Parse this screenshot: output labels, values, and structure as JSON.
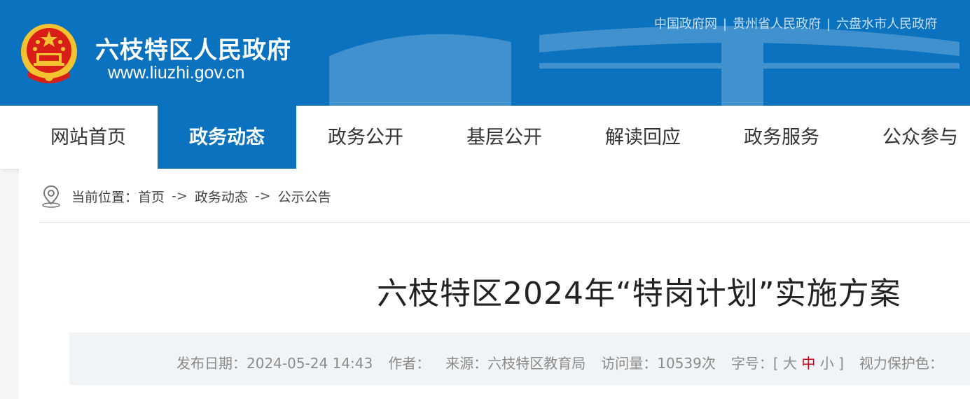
{
  "header": {
    "site_name": "六枝特区人民政府",
    "site_url": "www.liuzhi.gov.cn",
    "top_links": [
      "中国政府网",
      "贵州省人民政府",
      "六盘水市人民政府"
    ],
    "colors": {
      "brand_blue": "#0a72bf",
      "emblem_red": "#d91e18",
      "emblem_gold": "#f4c430"
    }
  },
  "nav": {
    "items": [
      {
        "label": "网站首页"
      },
      {
        "label": "政务动态",
        "active": true
      },
      {
        "label": "政务公开"
      },
      {
        "label": "基层公开"
      },
      {
        "label": "解读回应"
      },
      {
        "label": "政务服务"
      },
      {
        "label": "公众参与"
      }
    ]
  },
  "breadcrumb": {
    "prefix": "当前位置：",
    "items": [
      "首页",
      "政务动态",
      "公示公告"
    ],
    "separator": "->"
  },
  "article": {
    "title": "六枝特区2024年“特岗计划”实施方案",
    "meta": {
      "date_label": "发布日期：",
      "date": "2024-05-24 14:43",
      "author_label": "作者：",
      "source_label": "来源：",
      "source": "六枝特区教育局",
      "views_label": "访问量：",
      "views": "10539次",
      "font_size_label": "字号：",
      "font_open": "[",
      "font_large": "大",
      "font_medium": "中",
      "font_small": "小",
      "font_close": "]",
      "eye_care_label": "视力保护色："
    }
  }
}
